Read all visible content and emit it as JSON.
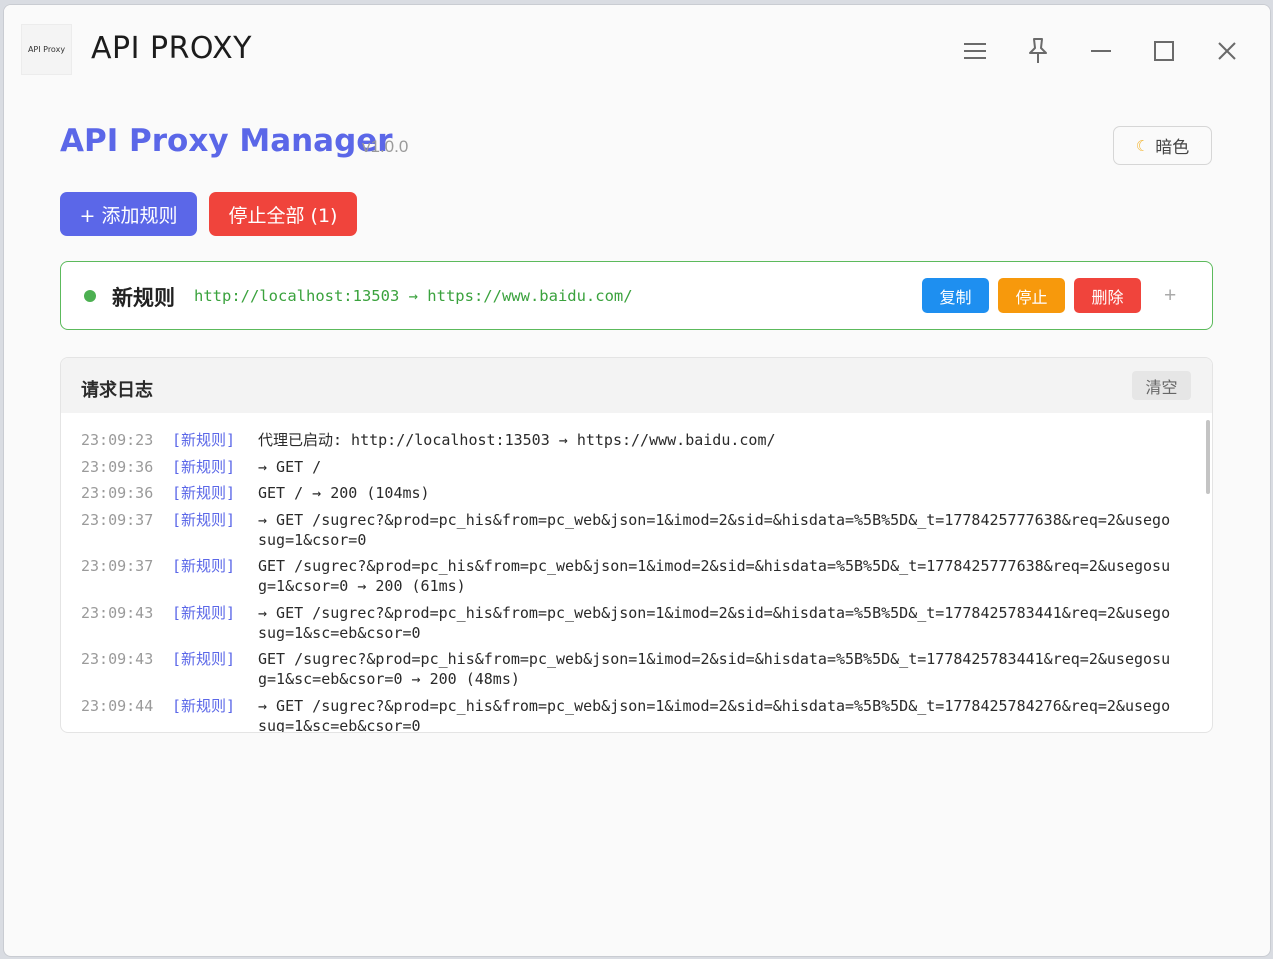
{
  "window": {
    "logo_text": "API Proxy",
    "title": "API PROXY"
  },
  "header": {
    "title": "API Proxy Manager",
    "version": "v1.0.0",
    "theme_label": "暗色",
    "theme_icon": "moon-icon"
  },
  "actions": {
    "add_label": "+ 添加规则",
    "stop_all_label": "停止全部 (1)"
  },
  "rule": {
    "name": "新规则",
    "mapping": "http://localhost:13503 → https://www.baidu.com/",
    "copy_label": "复制",
    "stop_label": "停止",
    "delete_label": "删除",
    "expand_label": "+"
  },
  "log": {
    "title": "请求日志",
    "clear_label": "清空",
    "entries": [
      {
        "time": "23:09:23",
        "rule": "[新规则]",
        "msg": "代理已启动: http://localhost:13503 → https://www.baidu.com/"
      },
      {
        "time": "23:09:36",
        "rule": "[新规则]",
        "msg": "→ GET /"
      },
      {
        "time": "23:09:36",
        "rule": "[新规则]",
        "msg": "GET / → 200 (104ms)"
      },
      {
        "time": "23:09:37",
        "rule": "[新规则]",
        "msg": "→ GET /sugrec?&prod=pc_his&from=pc_web&json=1&imod=2&sid=&hisdata=%5B%5D&_t=1778425777638&req=2&usegosug=1&csor=0"
      },
      {
        "time": "23:09:37",
        "rule": "[新规则]",
        "msg": "GET /sugrec?&prod=pc_his&from=pc_web&json=1&imod=2&sid=&hisdata=%5B%5D&_t=1778425777638&req=2&usegosug=1&csor=0 → 200 (61ms)"
      },
      {
        "time": "23:09:43",
        "rule": "[新规则]",
        "msg": "→ GET /sugrec?&prod=pc_his&from=pc_web&json=1&imod=2&sid=&hisdata=%5B%5D&_t=1778425783441&req=2&usegosug=1&sc=eb&csor=0"
      },
      {
        "time": "23:09:43",
        "rule": "[新规则]",
        "msg": "GET /sugrec?&prod=pc_his&from=pc_web&json=1&imod=2&sid=&hisdata=%5B%5D&_t=1778425783441&req=2&usegosug=1&sc=eb&csor=0 → 200 (48ms)"
      },
      {
        "time": "23:09:44",
        "rule": "[新规则]",
        "msg": "→ GET /sugrec?&prod=pc_his&from=pc_web&json=1&imod=2&sid=&hisdata=%5B%5D&_t=1778425784276&req=2&usegosug=1&sc=eb&csor=0"
      }
    ]
  },
  "colors": {
    "accent": "#5b67e8",
    "danger": "#f0443c",
    "warning": "#f7990c",
    "info": "#1e8ff0",
    "success": "#4cb051"
  }
}
